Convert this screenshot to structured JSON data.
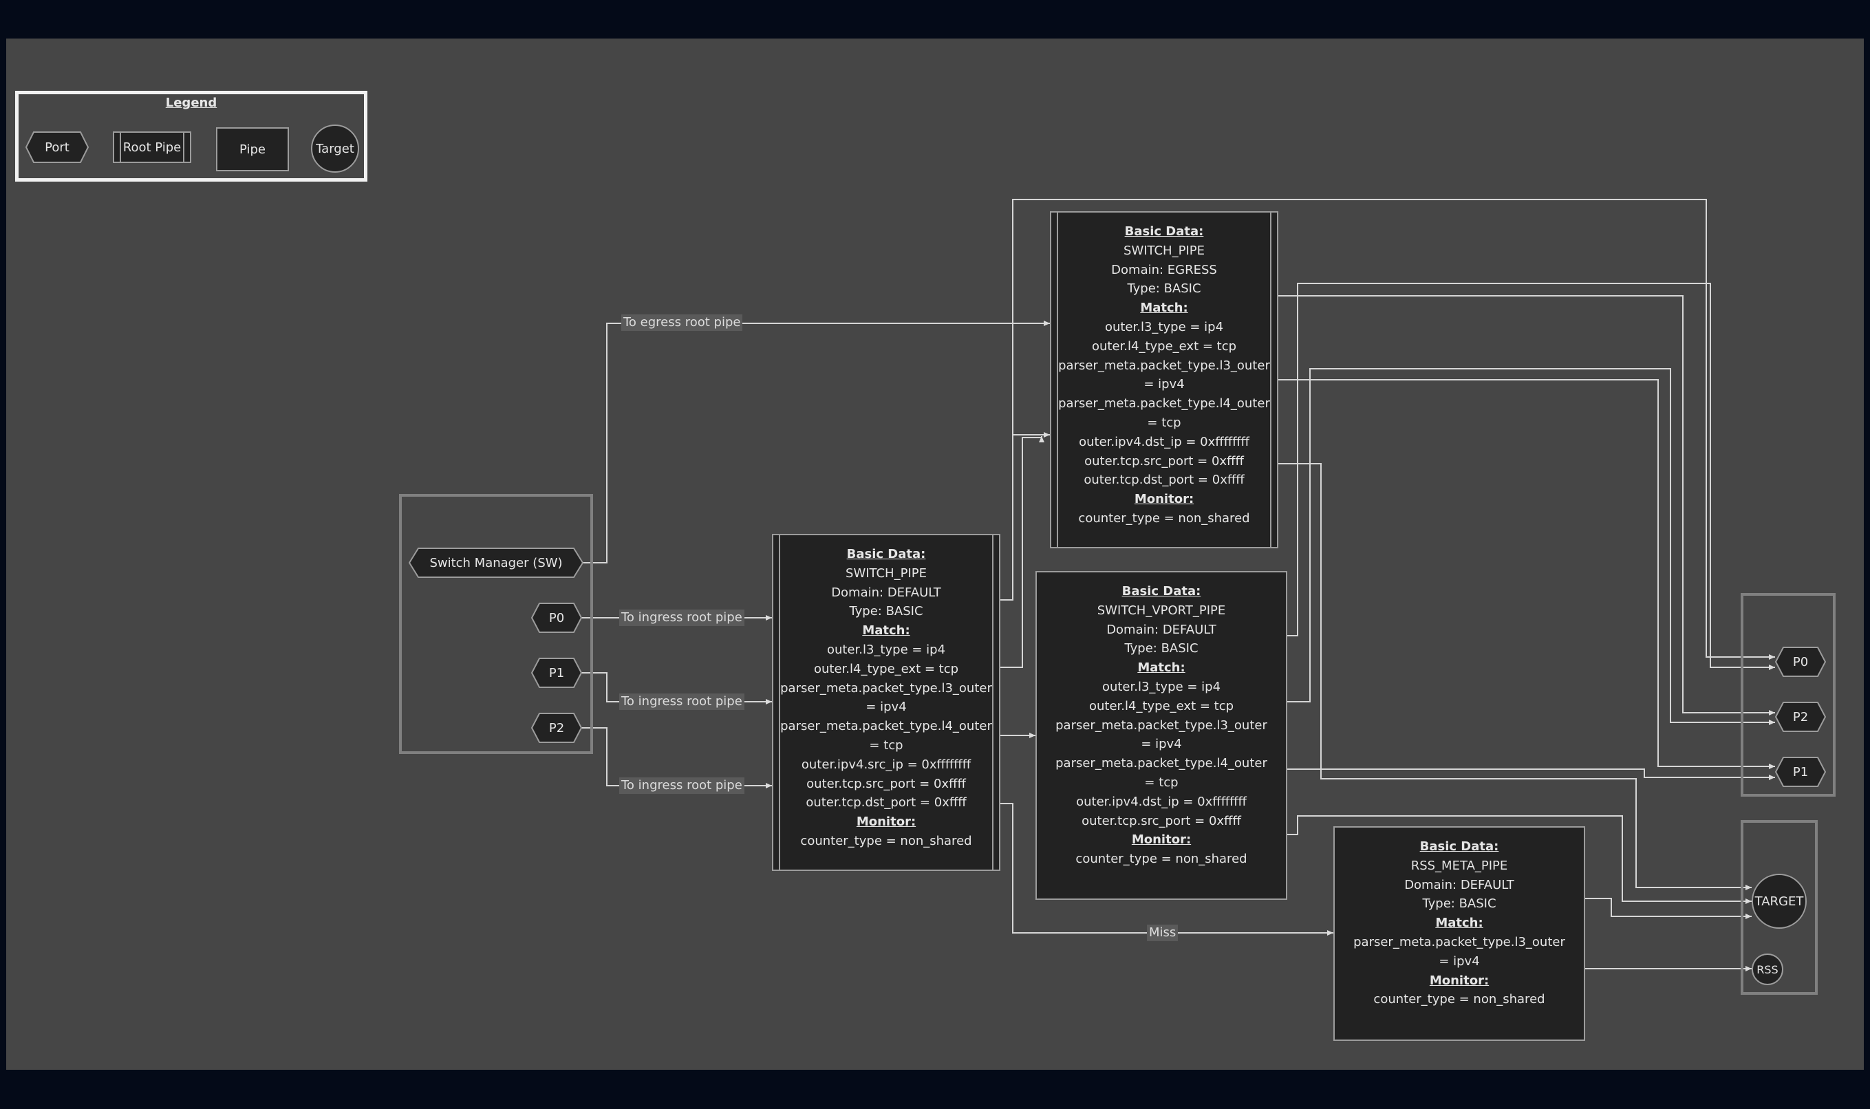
{
  "legend": {
    "title": "Legend",
    "port": "Port",
    "root_pipe": "Root Pipe",
    "pipe": "Pipe",
    "target": "Target"
  },
  "ports": {
    "switch_manager": "Switch Manager (SW)",
    "p0": "P0",
    "p1": "P1",
    "p2": "P2"
  },
  "edge_labels": {
    "egress": "To egress root pipe",
    "ingress_p0": "To ingress root pipe",
    "ingress_p1": "To ingress root pipe",
    "ingress_p2": "To ingress root pipe",
    "miss": "Miss"
  },
  "pipes": {
    "egress_root": {
      "basic_header": "Basic Data:",
      "name": "SWITCH_PIPE",
      "domain": "Domain: EGRESS",
      "type": "Type: BASIC",
      "match_header": "Match:",
      "match": [
        "outer.l3_type = ip4",
        "outer.l4_type_ext = tcp",
        "parser_meta.packet_type.l3_outer",
        "= ipv4",
        "parser_meta.packet_type.l4_outer",
        "= tcp",
        "outer.ipv4.dst_ip = 0xffffffff",
        "outer.tcp.src_port = 0xffff",
        "outer.tcp.dst_port = 0xffff"
      ],
      "monitor_header": "Monitor:",
      "monitor": "counter_type = non_shared"
    },
    "ingress_root": {
      "basic_header": "Basic Data:",
      "name": "SWITCH_PIPE",
      "domain": "Domain: DEFAULT",
      "type": "Type: BASIC",
      "match_header": "Match:",
      "match": [
        "outer.l3_type = ip4",
        "outer.l4_type_ext = tcp",
        "parser_meta.packet_type.l3_outer",
        "= ipv4",
        "parser_meta.packet_type.l4_outer",
        "= tcp",
        "outer.ipv4.src_ip = 0xffffffff",
        "outer.tcp.src_port = 0xffff",
        "outer.tcp.dst_port = 0xffff"
      ],
      "monitor_header": "Monitor:",
      "monitor": "counter_type = non_shared"
    },
    "vport": {
      "basic_header": "Basic Data:",
      "name": "SWITCH_VPORT_PIPE",
      "domain": "Domain: DEFAULT",
      "type": "Type: BASIC",
      "match_header": "Match:",
      "match": [
        "outer.l3_type = ip4",
        "outer.l4_type_ext = tcp",
        "parser_meta.packet_type.l3_outer",
        "= ipv4",
        "parser_meta.packet_type.l4_outer",
        "= tcp",
        "outer.ipv4.dst_ip = 0xffffffff",
        "outer.tcp.src_port = 0xffff"
      ],
      "monitor_header": "Monitor:",
      "monitor": "counter_type = non_shared"
    },
    "rss_meta": {
      "basic_header": "Basic Data:",
      "name": "RSS_META_PIPE",
      "domain": "Domain: DEFAULT",
      "type": "Type: BASIC",
      "match_header": "Match:",
      "match": [
        "parser_meta.packet_type.l3_outer",
        "= ipv4"
      ],
      "monitor_header": "Monitor:",
      "monitor": "counter_type = non_shared"
    }
  },
  "out_ports": {
    "p0": "P0",
    "p2": "P2",
    "p1": "P1"
  },
  "targets": {
    "target": "TARGET",
    "rss": "RSS"
  }
}
